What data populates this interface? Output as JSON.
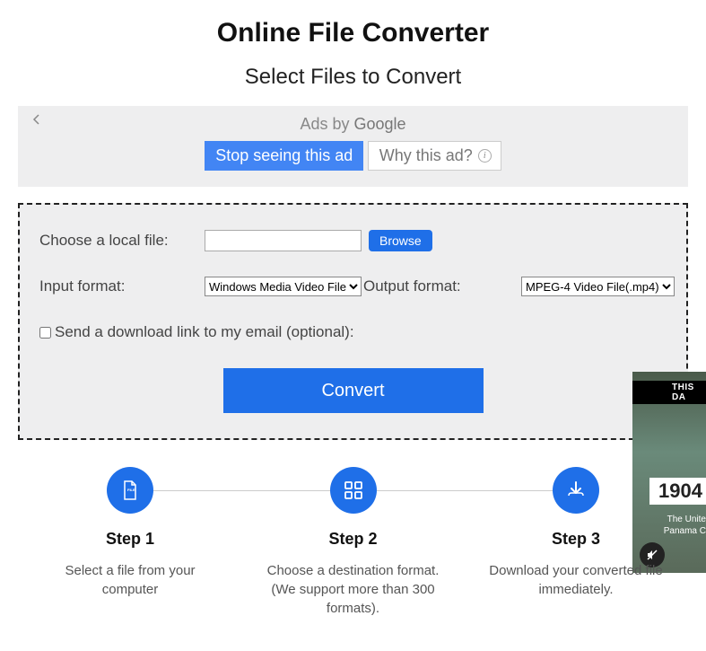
{
  "header": {
    "title": "Online File Converter",
    "subtitle": "Select Files to Convert"
  },
  "ad": {
    "prefix": "Ads by ",
    "brand": "Google",
    "stop": "Stop seeing this ad",
    "why": "Why this ad?"
  },
  "form": {
    "choose_label": "Choose a local file:",
    "browse": "Browse",
    "input_format_label": "Input format:",
    "input_format_value": "Windows Media Video File(.wmv)",
    "output_format_label": "Output format:",
    "output_format_value": "MPEG-4 Video File(.mp4)",
    "email_label": "Send a download link to my email (optional):",
    "convert": "Convert"
  },
  "steps": [
    {
      "title": "Step 1",
      "desc": "Select a file from your computer"
    },
    {
      "title": "Step 2",
      "desc": "Choose a destination format. (We support more than 300 formats)."
    },
    {
      "title": "Step 3",
      "desc": "Download your converted file immediately."
    }
  ],
  "video": {
    "band": "THIS DA",
    "year": "1904",
    "line1": "The Unite",
    "line2": "Panama C"
  }
}
